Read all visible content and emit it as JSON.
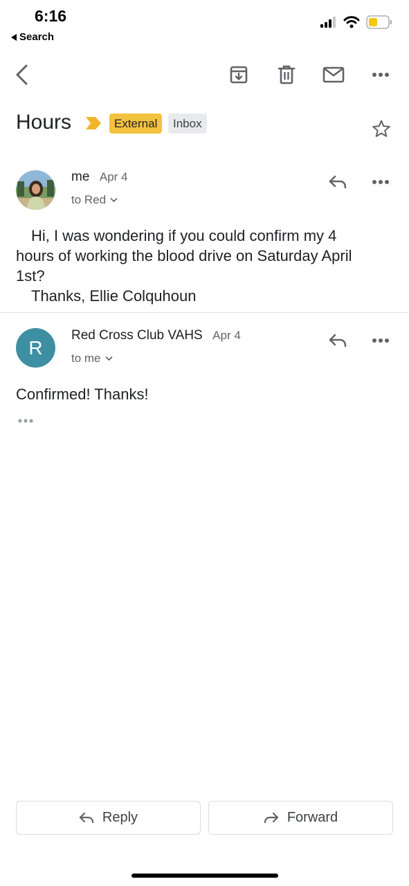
{
  "status_bar": {
    "time": "6:16",
    "back_label": "Search"
  },
  "toolbar": {
    "icons": [
      "back-icon",
      "archive-icon",
      "trash-icon",
      "mark-unread-icon",
      "more-icon"
    ]
  },
  "subject": "Hours",
  "labels": {
    "external": "External",
    "inbox": "Inbox"
  },
  "messages": [
    {
      "sender": "me",
      "date": "Apr 4",
      "to": "to Red",
      "body": [
        "Hi, I was wondering if you could confirm my 4",
        "hours of working the blood drive on Saturday April",
        "1st?",
        "Thanks, Ellie Colquhoun"
      ]
    },
    {
      "sender": "Red Cross Club VAHS",
      "avatar_letter": "R",
      "date": "Apr 4",
      "to": "to me",
      "body": [
        "Confirmed! Thanks!"
      ]
    }
  ],
  "actions": {
    "reply": "Reply",
    "forward": "Forward"
  },
  "colors": {
    "external_chip": "#f3c23e",
    "avatar_r": "#3f8fa2",
    "important_marker": "#f2b52a"
  }
}
